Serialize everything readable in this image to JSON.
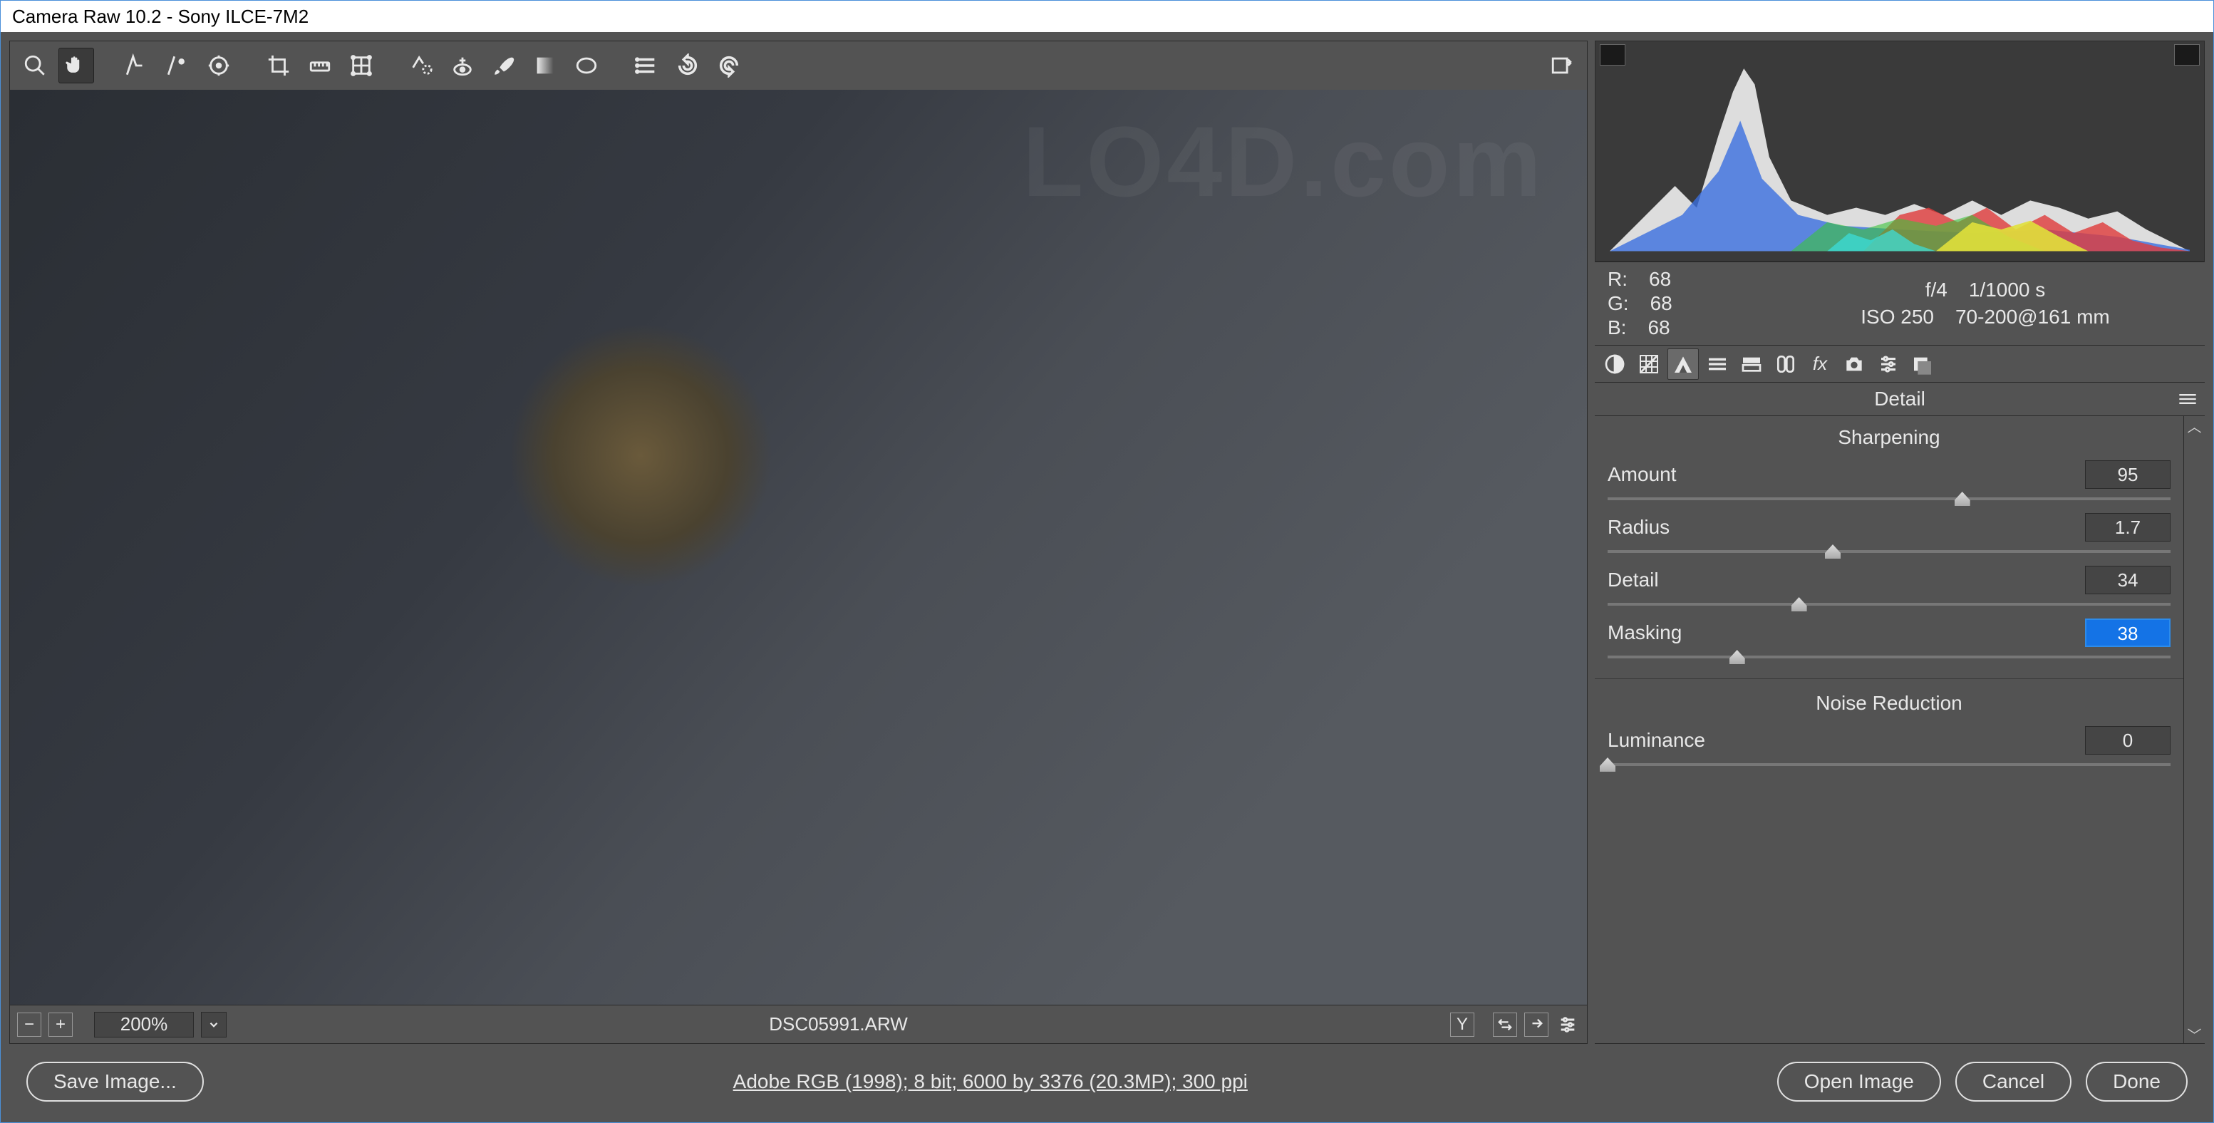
{
  "window": {
    "title": "Camera Raw 10.2  -  Sony ILCE-7M2"
  },
  "toolbar": {
    "tools": [
      "zoom",
      "hand",
      "white-balance",
      "color-sampler",
      "target-adjust",
      "crop",
      "straighten",
      "transform",
      "spot-removal",
      "red-eye",
      "brush",
      "graduated-filter",
      "radial-filter",
      "list",
      "rotate-ccw",
      "rotate-cw"
    ],
    "export_icon": "export"
  },
  "preview": {
    "filename": "DSC05991.ARW",
    "zoom": "200%"
  },
  "readout": {
    "r_label": "R:",
    "r_val": "68",
    "g_label": "G:",
    "g_val": "68",
    "b_label": "B:",
    "b_val": "68",
    "aperture": "f/4",
    "shutter": "1/1000 s",
    "iso": "ISO 250",
    "lens": "70-200@161 mm"
  },
  "tabs": [
    "basic",
    "tone-curve",
    "detail",
    "hsl",
    "split-toning",
    "lens",
    "effects",
    "camera",
    "presets",
    "snapshots"
  ],
  "active_tab": 2,
  "panel": {
    "title": "Detail",
    "sharpening_header": "Sharpening",
    "noise_header": "Noise Reduction",
    "sliders": {
      "amount": {
        "label": "Amount",
        "value": "95",
        "pos": 63
      },
      "radius": {
        "label": "Radius",
        "value": "1.7",
        "pos": 40
      },
      "detail": {
        "label": "Detail",
        "value": "34",
        "pos": 34
      },
      "masking": {
        "label": "Masking",
        "value": "38",
        "pos": 23,
        "active": true
      },
      "luminance": {
        "label": "Luminance",
        "value": "0",
        "pos": 0
      }
    }
  },
  "footer": {
    "save": "Save Image...",
    "workflow": "Adobe RGB (1998); 8 bit; 6000 by 3376 (20.3MP); 300 ppi",
    "open": "Open Image",
    "cancel": "Cancel",
    "done": "Done"
  }
}
